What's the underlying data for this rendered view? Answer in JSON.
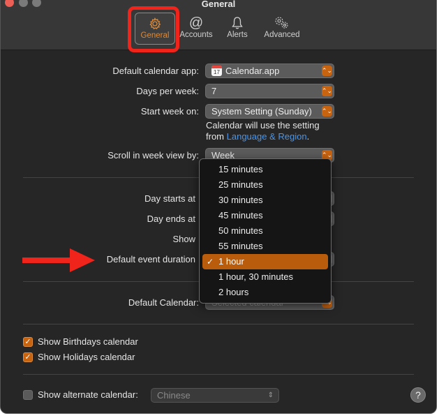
{
  "window": {
    "title": "General"
  },
  "tabs": [
    {
      "label": "General",
      "icon": "gear-icon",
      "active": true
    },
    {
      "label": "Accounts",
      "icon": "at-sign-icon",
      "active": false
    },
    {
      "label": "Alerts",
      "icon": "bell-icon",
      "active": false
    },
    {
      "label": "Advanced",
      "icon": "gears-icon",
      "active": false
    }
  ],
  "settings": {
    "default_calendar_app": {
      "label": "Default calendar app:",
      "value": "Calendar.app",
      "icon_day": "17"
    },
    "days_per_week": {
      "label": "Days per week:",
      "value": "7"
    },
    "start_week_on": {
      "label": "Start week on:",
      "value": "System Setting (Sunday)"
    },
    "note": {
      "text": "Calendar will use the setting",
      "from": "from ",
      "link": "Language & Region",
      "period": "."
    },
    "scroll_week_view": {
      "label": "Scroll in week view by:",
      "value": "Week"
    },
    "day_starts_at": {
      "label": "Day starts at"
    },
    "day_ends_at": {
      "label": "Day ends at"
    },
    "show": {
      "label": "Show"
    },
    "default_event_duration": {
      "label": "Default event duration"
    },
    "default_calendar": {
      "label": "Default Calendar:",
      "value": "Selected calendar"
    }
  },
  "dropdown": {
    "options": [
      "15 minutes",
      "25 minutes",
      "30 minutes",
      "45 minutes",
      "50 minutes",
      "55 minutes",
      "1 hour",
      "1 hour, 30 minutes",
      "2 hours"
    ],
    "selected": "1 hour",
    "check": "✓"
  },
  "checkboxes": [
    {
      "label": "Show Birthdays calendar",
      "checked": true
    },
    {
      "label": "Show Holidays calendar",
      "checked": true
    },
    {
      "label": "Show alternate calendar:",
      "checked": false
    }
  ],
  "alternate_calendar": {
    "value": "Chinese"
  },
  "help": {
    "label": "?"
  },
  "colors": {
    "accent": "#c8630f",
    "annotation_red": "#f0241a",
    "link": "#4b95e8"
  }
}
